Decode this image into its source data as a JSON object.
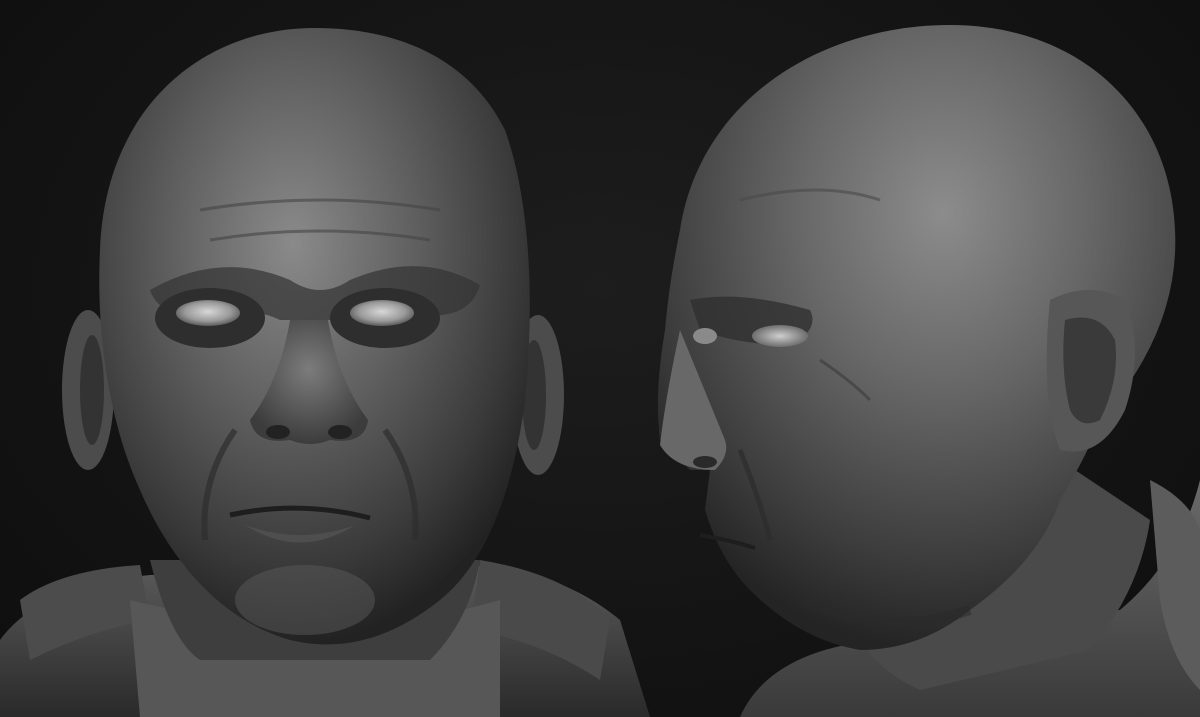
{
  "scene": {
    "background_color": "#141414",
    "material_color": "#6e6e6e",
    "renders": [
      {
        "view": "front"
      },
      {
        "view": "three-quarter-right"
      }
    ]
  }
}
